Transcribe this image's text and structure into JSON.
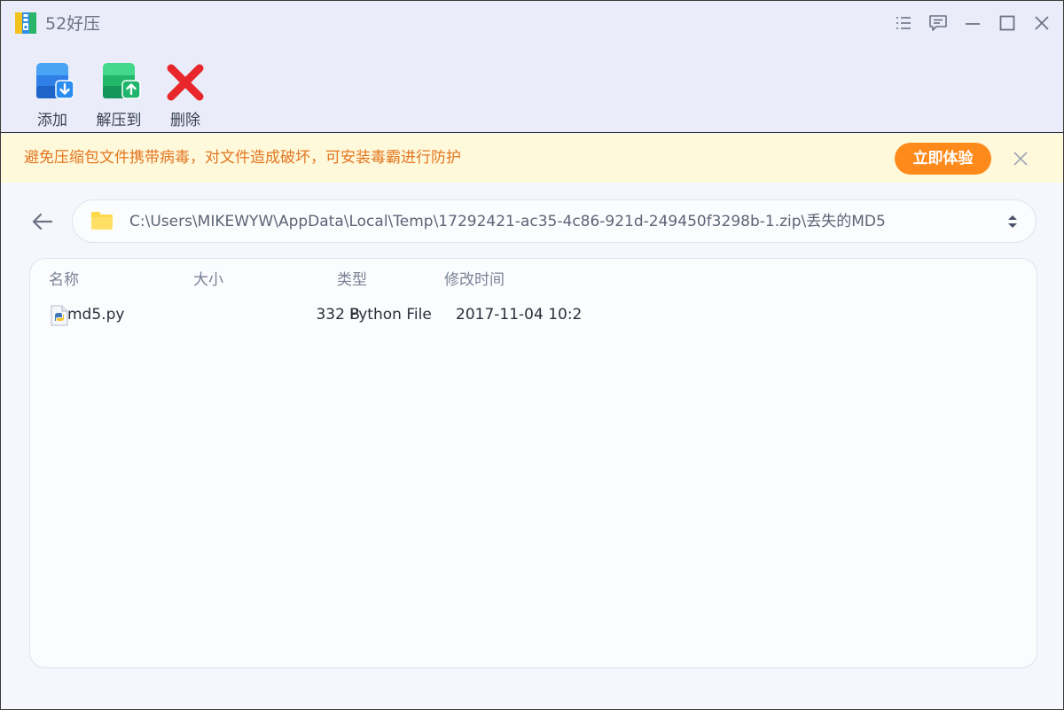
{
  "app": {
    "title": "52好压"
  },
  "window_controls": [
    "menu-icon",
    "feedback-icon",
    "minimize-icon",
    "maximize-icon",
    "close-icon"
  ],
  "toolbar": {
    "add_label": "添加",
    "extract_label": "解压到",
    "delete_label": "删除"
  },
  "banner": {
    "text": "避免压缩包文件携带病毒，对文件造成破坏，可安装毒霸进行防护",
    "button_label": "立即体验"
  },
  "path": {
    "value": "C:\\Users\\MIKEWYW\\AppData\\Local\\Temp\\17292421-ac35-4c86-921d-249450f3298b-1.zip\\丢失的MD5"
  },
  "columns": {
    "name": "名称",
    "size": "大小",
    "type": "类型",
    "modified": "修改时间"
  },
  "files": [
    {
      "name": "md5.py",
      "size": "332 B",
      "type": "Python File",
      "modified": "2017-11-04 10:2",
      "icon": "python-file-icon"
    }
  ],
  "colors": {
    "chrome_bg": "#eaedf9",
    "banner_bg": "#fff9dc",
    "banner_text": "#e2761f",
    "accent_orange": "#ff8a1c",
    "add_blue": "#2f7fe6",
    "extract_green": "#22b86a",
    "delete_red": "#e8262c"
  }
}
